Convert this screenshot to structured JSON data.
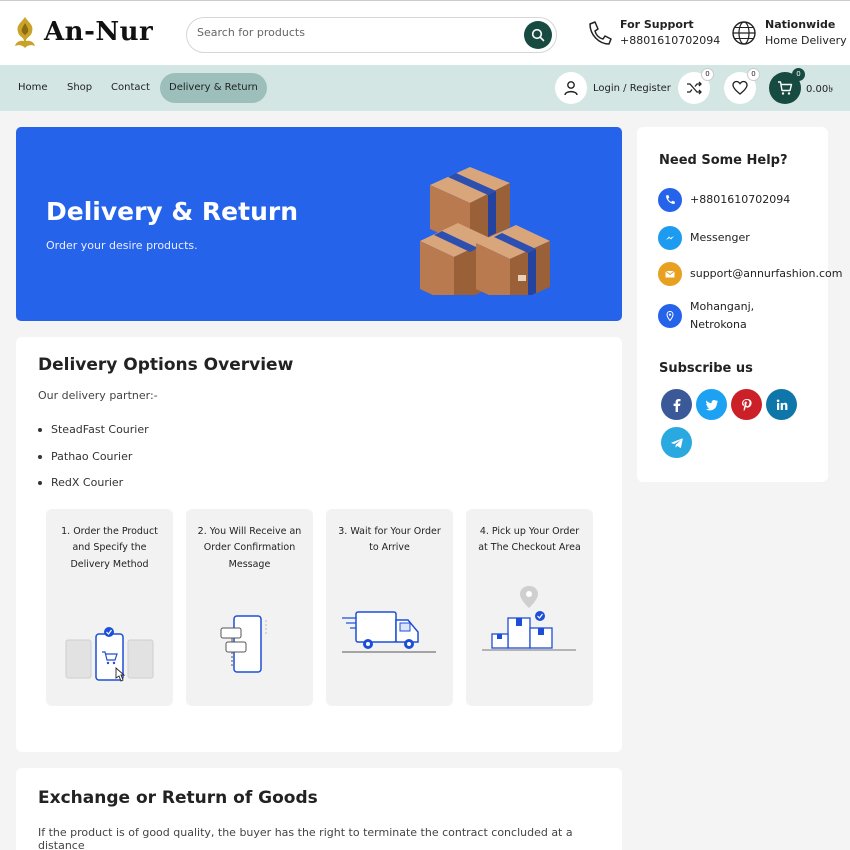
{
  "brand": {
    "name": "An-Nur"
  },
  "search": {
    "placeholder": "Search for products"
  },
  "header": {
    "support": {
      "title": "For Support",
      "phone": "+8801610702094"
    },
    "delivery": {
      "title": "Nationwide",
      "subtitle": "Home Delivery"
    }
  },
  "nav": {
    "items": [
      {
        "label": "Home"
      },
      {
        "label": "Shop"
      },
      {
        "label": "Contact"
      },
      {
        "label": "Delivery & Return",
        "active": true
      }
    ],
    "account_label": "Login / Register",
    "compare_count": "0",
    "wishlist_count": "0",
    "cart_count": "0",
    "cart_total": "0.00৳"
  },
  "hero": {
    "title": "Delivery & Return",
    "subtitle": "Order your desire products.",
    "color": "#2563eb"
  },
  "options": {
    "title": "Delivery Options Overview",
    "intro": "Our delivery partner:-",
    "partners": [
      "SteadFast Courier",
      "Pathao Courier",
      "RedX Courier"
    ],
    "steps": [
      {
        "label": "1. Order the Product and Specify the Delivery Method"
      },
      {
        "label": "2. You Will Receive an Order Confirmation Message"
      },
      {
        "label": "3. Wait for Your Order to Arrive"
      },
      {
        "label": "4. Pick up Your Order at The Checkout Area"
      }
    ]
  },
  "exchange": {
    "title": "Exchange or Return of Goods",
    "text": "If the product is of good quality, the buyer has the right to terminate the contract concluded at a distance"
  },
  "sidebar": {
    "help_title": "Need Some Help?",
    "contacts": [
      {
        "icon": "phone-icon",
        "text": "+8801610702094",
        "color": "#2563eb"
      },
      {
        "icon": "messenger-icon",
        "text": "Messenger",
        "color": "#1d9bf0"
      },
      {
        "icon": "mail-icon",
        "text": "support@annurfashion.com",
        "color": "#e8a020"
      },
      {
        "icon": "location-icon",
        "text": "Mohanganj, Netrokona",
        "color": "#2563eb"
      }
    ],
    "subscribe_title": "Subscribe us",
    "socials": [
      {
        "icon": "facebook-icon",
        "color": "#3b5998"
      },
      {
        "icon": "twitter-icon",
        "color": "#1da1f2"
      },
      {
        "icon": "pinterest-icon",
        "color": "#cb2027"
      },
      {
        "icon": "linkedin-icon",
        "color": "#0e76a8"
      },
      {
        "icon": "telegram-icon",
        "color": "#29a9df"
      }
    ]
  },
  "colors": {
    "primary": "#174a40",
    "nav_bg": "#d3e6e4",
    "nav_active": "#9cbfbb",
    "accent": "#2563eb"
  }
}
